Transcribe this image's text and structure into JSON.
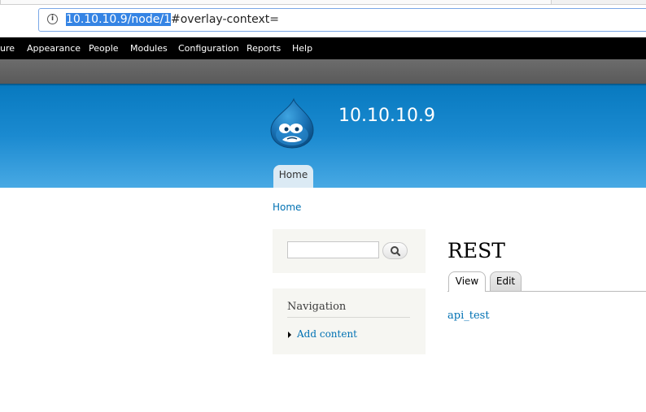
{
  "browser": {
    "url_selected": "10.10.10.9/node/1",
    "url_rest": "#overlay-context="
  },
  "admin_toolbar": {
    "items": [
      "ure",
      "Appearance",
      "People",
      "Modules",
      "Configuration",
      "Reports",
      "Help"
    ]
  },
  "header": {
    "site_name": "10.10.10.9",
    "main_menu": [
      "Home"
    ]
  },
  "breadcrumb": "Home",
  "search": {
    "value": "",
    "button_icon": "magnifier-icon"
  },
  "navigation_block": {
    "title": "Navigation",
    "links": [
      "Add content"
    ]
  },
  "node": {
    "title": "REST",
    "tabs": [
      "View",
      "Edit"
    ],
    "active_tab": "View",
    "body_link": "api_test"
  },
  "colors": {
    "header_blue": "#0779bf",
    "link_blue": "#0071b3",
    "admin_bar": "#000000"
  }
}
